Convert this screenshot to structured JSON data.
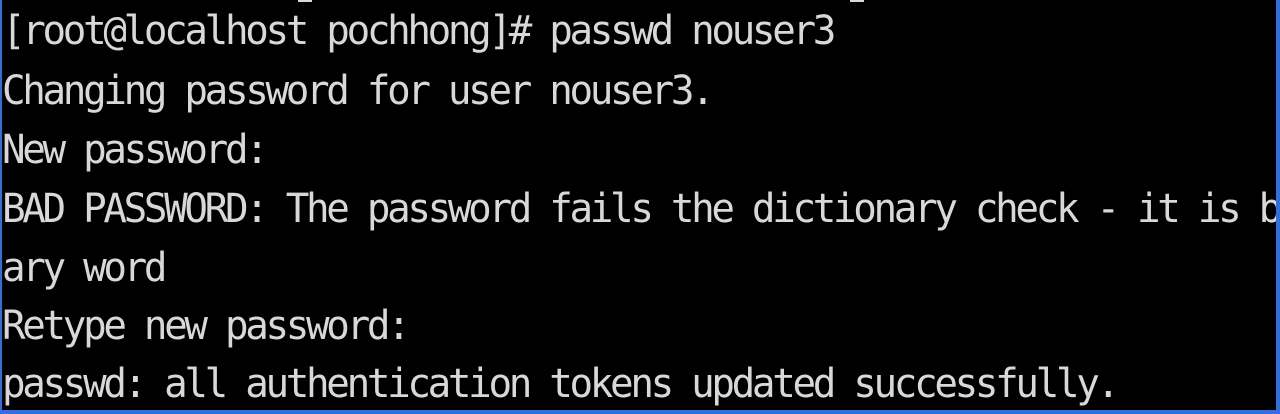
{
  "terminal": {
    "lines": [
      "[root@localhost pochhong]# passwd nouser3",
      "Changing password for user nouser3.",
      "New password:",
      "BAD PASSWORD: The password fails the dictionary check - it is based on a diction",
      "ary word",
      "Retype new password:",
      "passwd: all authentication tokens updated successfully."
    ]
  },
  "colors": {
    "background": "#000000",
    "foreground": "#d8d8d8",
    "window_border": "#2f6fe0"
  }
}
